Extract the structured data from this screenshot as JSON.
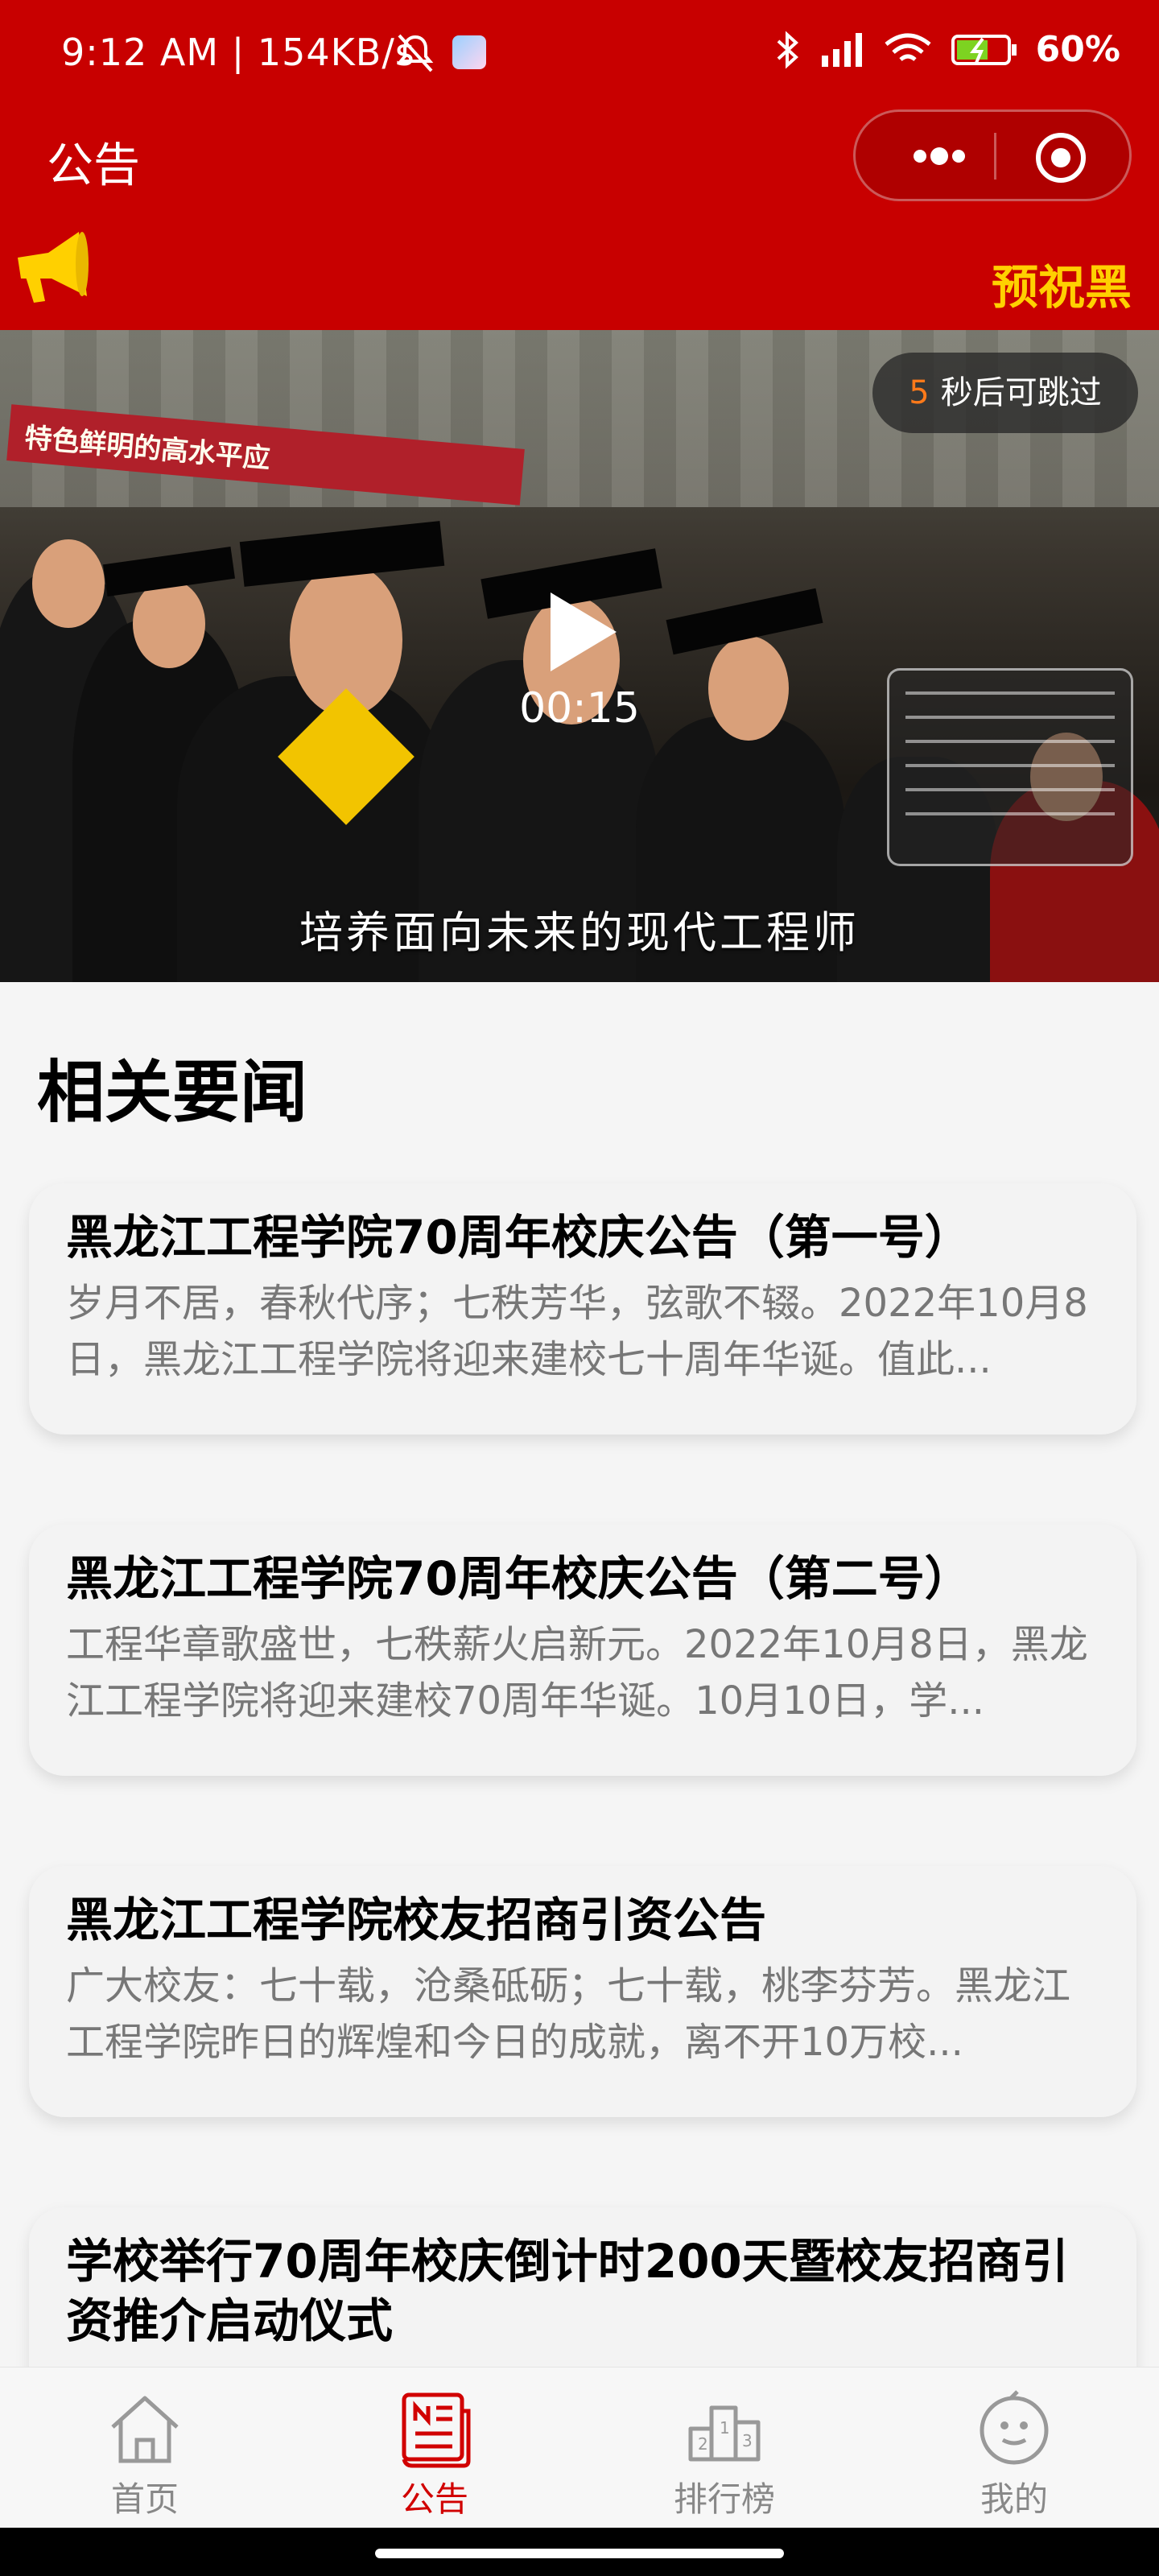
{
  "status_bar": {
    "time_speed": "9:12 AM | 154KB/s",
    "battery": "60%"
  },
  "header": {
    "title": "公告"
  },
  "notice": {
    "marquee_text": "预祝黑"
  },
  "video": {
    "skip_count": "5",
    "skip_text": "秒后可跳过",
    "elapsed": "00:15",
    "subtitle": "培养面向未来的现代工程师",
    "banner_text": "特色鲜明的高水平应"
  },
  "section": {
    "title": "相关要闻"
  },
  "news": [
    {
      "title": "黑龙江工程学院70周年校庆公告（第一号）",
      "summary": "岁月不居，春秋代序；七秩芳华，弦歌不辍。2022年10月8日，黑龙江工程学院将迎来建校七十周年华诞。值此..."
    },
    {
      "title": "黑龙江工程学院70周年校庆公告（第二号）",
      "summary": "工程华章歌盛世，七秩薪火启新元。2022年10月8日，黑龙江工程学院将迎来建校70周年华诞。10月10日，学..."
    },
    {
      "title": "黑龙江工程学院校友招商引资公告",
      "summary": "广大校友：七十载，沧桑砥砺；七十载，桃李芬芳。黑龙江工程学院昨日的辉煌和今日的成就，离不开10万校..."
    },
    {
      "title": "学校举行70周年校庆倒计时200天暨校友招商引资推介启动仪式",
      "summary": ""
    }
  ],
  "tabs": [
    {
      "label": "首页",
      "icon": "home-icon",
      "active": false
    },
    {
      "label": "公告",
      "icon": "notice-icon",
      "active": true
    },
    {
      "label": "排行榜",
      "icon": "ranking-icon",
      "active": false
    },
    {
      "label": "我的",
      "icon": "profile-icon",
      "active": false
    }
  ],
  "colors": {
    "brand_red": "#c80000",
    "marquee_yellow": "#ffd000",
    "active_tab": "#d10000"
  }
}
